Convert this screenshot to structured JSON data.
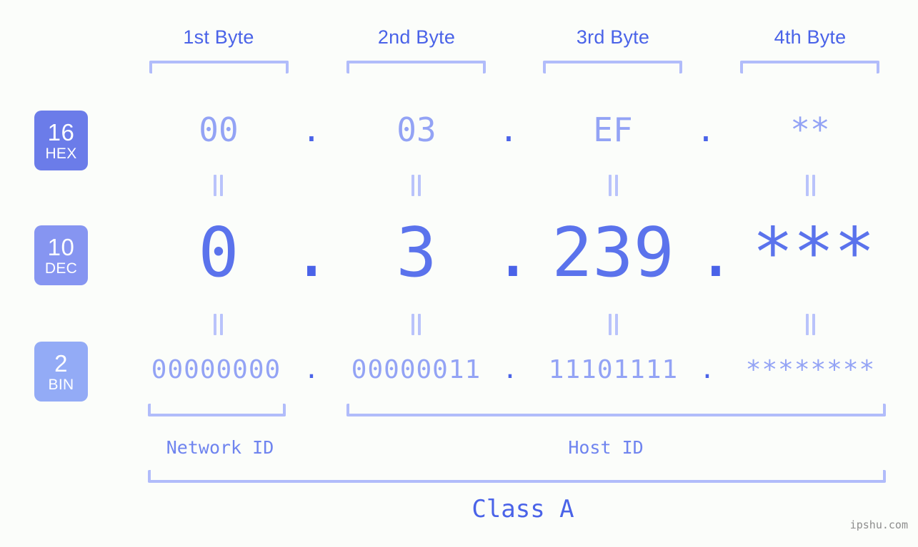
{
  "diagram": {
    "title": "IP address byte breakdown",
    "background_color": "#fbfdfa",
    "accent_color": "#4a63e8",
    "light_accent_color": "#93a3f5",
    "bracket_color": "#b1bcfa"
  },
  "byte_headers": [
    {
      "label": "1st Byte"
    },
    {
      "label": "2nd Byte"
    },
    {
      "label": "3rd Byte"
    },
    {
      "label": "4th Byte"
    }
  ],
  "rows": [
    {
      "radix_number": "16",
      "radix_name": "HEX",
      "badge_color": "#6b7ce9",
      "values": [
        "00",
        "03",
        "EF",
        "**"
      ],
      "separator": "."
    },
    {
      "radix_number": "10",
      "radix_name": "DEC",
      "badge_color": "#8695f1",
      "values": [
        "0",
        "3",
        "239",
        "***"
      ],
      "separator": "."
    },
    {
      "radix_number": "2",
      "radix_name": "BIN",
      "badge_color": "#93abf6",
      "values": [
        "00000000",
        "00000011",
        "11101111",
        "********"
      ],
      "separator": "."
    }
  ],
  "segments": [
    {
      "label": "Network ID"
    },
    {
      "label": "Host ID"
    }
  ],
  "class_label": "Class A",
  "watermark": "ipshu.com"
}
